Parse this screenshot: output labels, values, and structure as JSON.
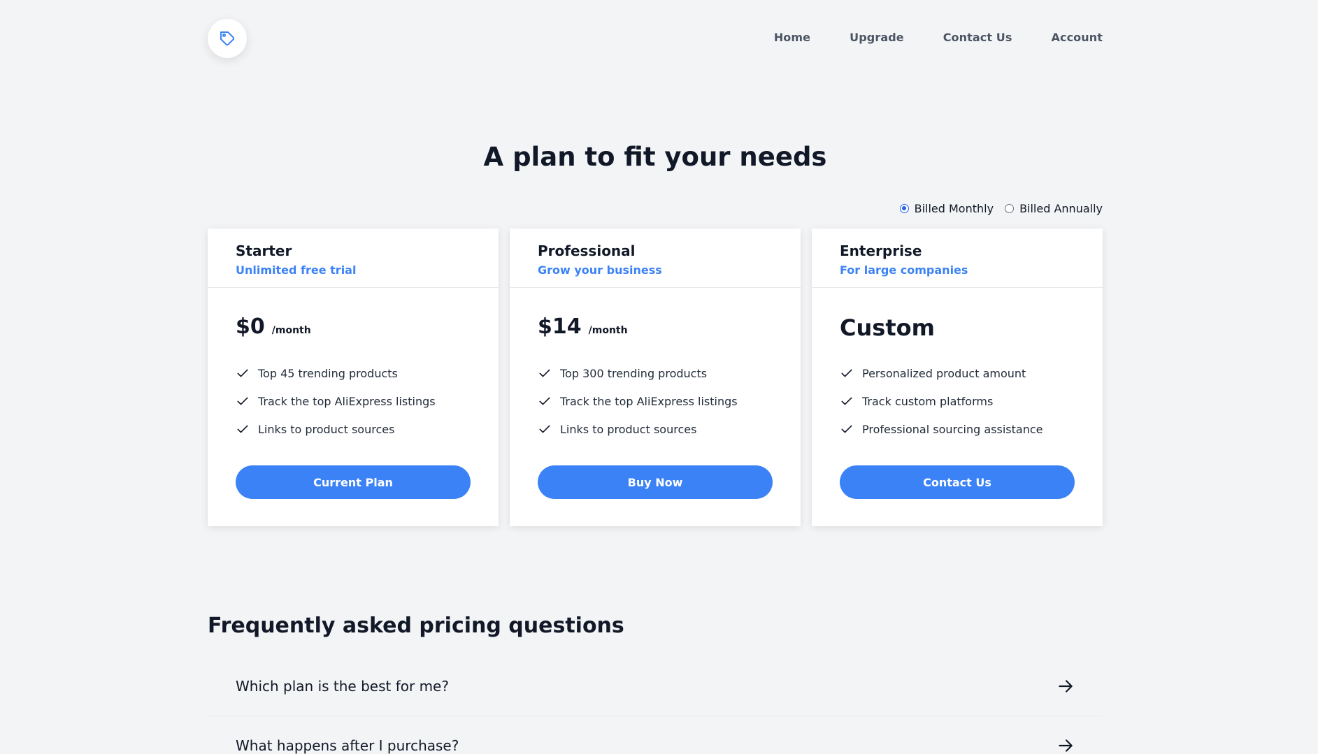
{
  "header": {
    "logo_icon": "tag-icon",
    "nav": [
      {
        "label": "Home"
      },
      {
        "label": "Upgrade"
      },
      {
        "label": "Contact Us"
      },
      {
        "label": "Account"
      }
    ]
  },
  "hero": {
    "title": "A plan to fit your needs"
  },
  "billing": {
    "selected": "monthly",
    "monthly_label": "Billed Monthly",
    "annually_label": "Billed Annually"
  },
  "plans": [
    {
      "name": "Starter",
      "subtitle": "Unlimited free trial",
      "price": "$0",
      "period": "/month",
      "features": [
        "Top 45 trending products",
        "Track the top AliExpress listings",
        "Links to product sources"
      ],
      "cta": "Current Plan"
    },
    {
      "name": "Professional",
      "subtitle": "Grow your business",
      "price": "$14",
      "period": "/month",
      "features": [
        "Top 300 trending products",
        "Track the top AliExpress listings",
        "Links to product sources"
      ],
      "cta": "Buy Now"
    },
    {
      "name": "Enterprise",
      "subtitle": "For large companies",
      "price": "Custom",
      "period": "",
      "features": [
        "Personalized product amount",
        "Track custom platforms",
        "Professional sourcing assistance"
      ],
      "cta": "Contact Us"
    }
  ],
  "faq": {
    "title": "Frequently asked pricing questions",
    "items": [
      {
        "question": "Which plan is the best for me?"
      },
      {
        "question": "What happens after I purchase?"
      }
    ]
  },
  "colors": {
    "accent": "#3b82f6",
    "background": "#f3f4f6"
  }
}
